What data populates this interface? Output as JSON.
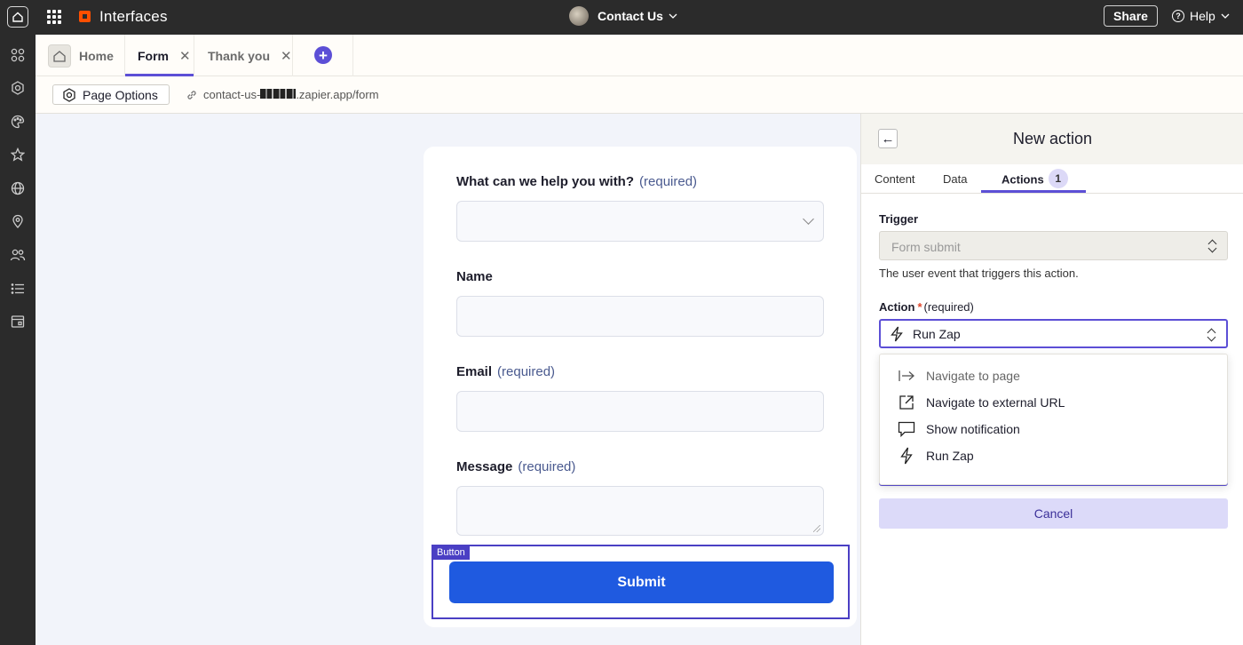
{
  "topbar": {
    "app_title": "Interfaces",
    "page_name": "Contact Us",
    "share_label": "Share",
    "help_label": "Help",
    "help_glyph": "?"
  },
  "tabs": [
    {
      "label": "Home"
    },
    {
      "label": "Form"
    },
    {
      "label": "Thank you"
    }
  ],
  "add_tab_glyph": "+",
  "page_options": {
    "label": "Page Options",
    "url_prefix": "contact-us-",
    "url_suffix": ".zapier.app/form"
  },
  "form": {
    "fields": [
      {
        "label": "What can we help you with?",
        "required": "(required)"
      },
      {
        "label": "Name",
        "required": ""
      },
      {
        "label": "Email",
        "required": "(required)"
      },
      {
        "label": "Message",
        "required": "(required)"
      }
    ],
    "button_tag": "Button",
    "submit_label": "Submit"
  },
  "panel": {
    "title": "New action",
    "back_glyph": "←",
    "tabs": [
      "Content",
      "Data",
      "Actions"
    ],
    "actions_badge": "1",
    "trigger_label": "Trigger",
    "trigger_value": "Form submit",
    "trigger_help": "The user event that triggers this action.",
    "action_label": "Action",
    "action_star": "*",
    "action_required": "(required)",
    "action_value": "Run Zap",
    "menu_items": [
      {
        "label": "Navigate to page",
        "icon": "arrow-right-bar-icon"
      },
      {
        "label": "Navigate to external URL",
        "icon": "external-link-icon"
      },
      {
        "label": "Show notification",
        "icon": "speech-bubble-icon"
      },
      {
        "label": "Run Zap",
        "icon": "lightning-icon"
      }
    ],
    "cancel_label": "Cancel"
  },
  "colors": {
    "accent": "#5c4fd6",
    "submit": "#1f5ae0",
    "brand": "#ff4f00",
    "topbar": "#2b2b2b"
  }
}
